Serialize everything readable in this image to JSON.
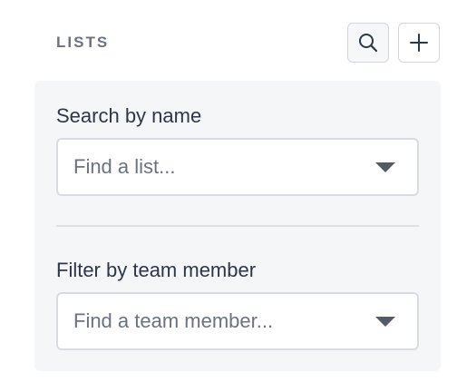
{
  "header": {
    "title": "LISTS",
    "search_icon": "search-icon",
    "add_icon": "plus-icon"
  },
  "filters": {
    "name": {
      "label": "Search by name",
      "placeholder": "Find a list..."
    },
    "member": {
      "label": "Filter by team member",
      "placeholder": "Find a team member..."
    }
  },
  "colors": {
    "panel_bg": "#f5f6f8",
    "text": "#2d3748",
    "muted": "#6b7280",
    "border": "#d8dbe0"
  }
}
